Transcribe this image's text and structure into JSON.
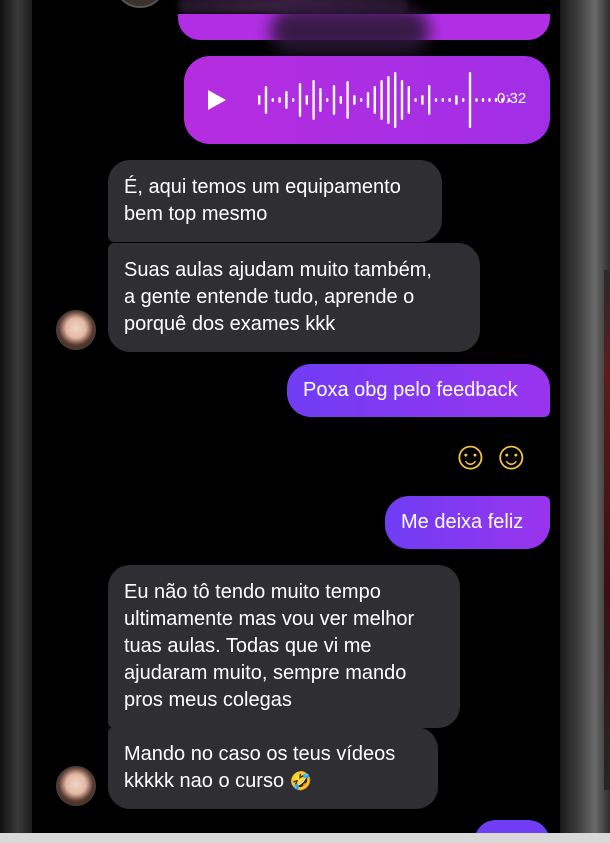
{
  "voice_message": {
    "duration": "0:32",
    "icon": "play-icon",
    "colors": {
      "start": "#b62ddf",
      "end": "#a12ee6"
    }
  },
  "messages": [
    {
      "from": "contact",
      "text": "É, aqui temos um equipamento\nbem top mesmo"
    },
    {
      "from": "contact",
      "text": "Suas aulas ajudam muito também,\na gente entende tudo,  aprende o\nporquê dos exames kkk"
    },
    {
      "from": "me",
      "text": "Poxa obg pelo feedback"
    },
    {
      "from": "me",
      "text": "☺☺"
    },
    {
      "from": "me",
      "text": "Me deixa feliz"
    },
    {
      "from": "contact",
      "text": "Eu não tô tendo muito tempo\nultimamente mas vou ver melhor\ntuas aulas. Todas que vi me\najudaram muito, sempre mando\npros meus colegas"
    },
    {
      "from": "contact",
      "text": "Mando no caso os teus vídeos\nkkkkk nao o curso",
      "emoji": "🤣"
    }
  ],
  "colors": {
    "incoming_bubble": "#2f2f33",
    "outgoing_bubble": "#6f3df4",
    "background": "#000000"
  }
}
